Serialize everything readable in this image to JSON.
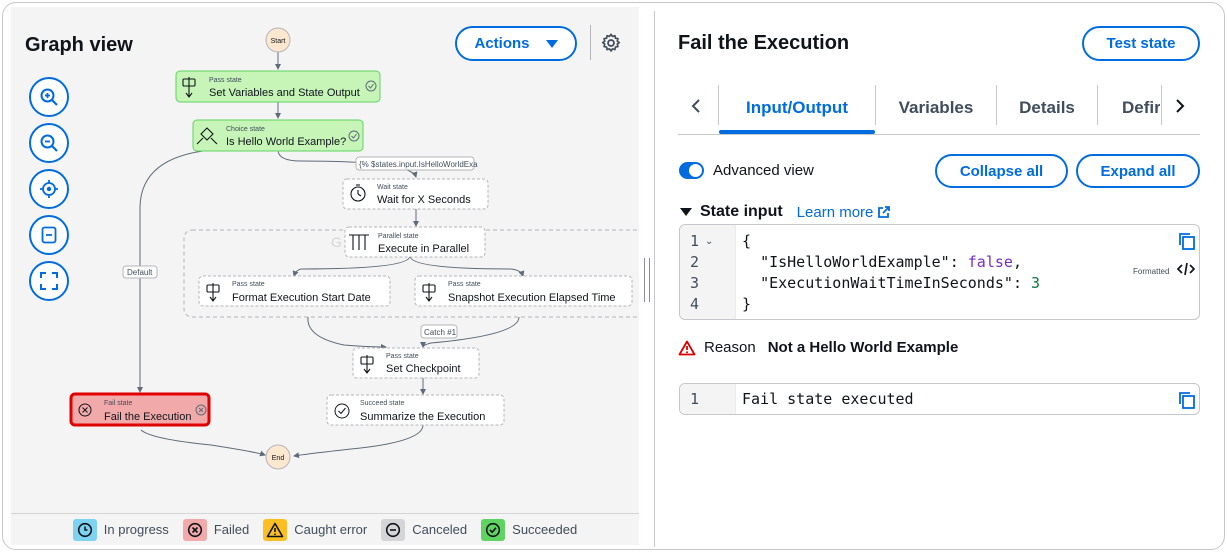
{
  "graph_panel": {
    "title": "Graph view",
    "actions_label": "Actions",
    "zoom_buttons": [
      "zoom-in",
      "zoom-out",
      "center",
      "fit",
      "fullscreen"
    ],
    "nodes": {
      "start": "Start",
      "end": "End",
      "set_vars": {
        "type": "Pass state",
        "name": "Set Variables and State Output"
      },
      "choice": {
        "type": "Choice state",
        "name": "Is Hello World Example?"
      },
      "wait": {
        "type": "Wait state",
        "name": "Wait for X Seconds"
      },
      "parallel": {
        "type": "Parallel state",
        "name": "Execute in Parallel"
      },
      "format_date": {
        "type": "Pass state",
        "name": "Format Execution Start Date"
      },
      "snapshot": {
        "type": "Pass state",
        "name": "Snapshot Execution Elapsed Time"
      },
      "checkpoint": {
        "type": "Pass state",
        "name": "Set Checkpoint"
      },
      "fail": {
        "type": "Fail state",
        "name": "Fail the Execution"
      },
      "succeed": {
        "type": "Succeed state",
        "name": "Summarize the Execution"
      }
    },
    "edge_labels": {
      "condition": "{% $states.input.IsHelloWorldExa",
      "default": "Default",
      "catch": "Catch #1"
    },
    "legend": [
      {
        "label": "In progress",
        "color": "#7dd3f0"
      },
      {
        "label": "Failed",
        "color": "#f2a9a9"
      },
      {
        "label": "Caught error",
        "color": "#fbbf24"
      },
      {
        "label": "Canceled",
        "color": "#d5d5d8"
      },
      {
        "label": "Succeeded",
        "color": "#5fd35f"
      }
    ]
  },
  "detail_panel": {
    "title": "Fail the Execution",
    "test_state_label": "Test state",
    "tabs": [
      {
        "label": "Input/Output",
        "active": true
      },
      {
        "label": "Variables",
        "active": false
      },
      {
        "label": "Details",
        "active": false
      },
      {
        "label": "Defir",
        "active": false
      }
    ],
    "advanced_view_label": "Advanced view",
    "advanced_view_on": true,
    "collapse_all_label": "Collapse all",
    "expand_all_label": "Expand all",
    "state_input_label": "State input",
    "learn_more_label": "Learn more",
    "formatted_label": "Formatted",
    "input_code": {
      "line_numbers": [
        "1",
        "2",
        "3",
        "4"
      ],
      "open_brace": "{",
      "key1": "\"IsHelloWorldExample\"",
      "val1": "false",
      "key2": "\"ExecutionWaitTimeInSeconds\"",
      "val2": "3",
      "close_brace": "}"
    },
    "reason_label": "Reason",
    "reason_value": "Not a Hello World Example",
    "output_code": {
      "line_number": "1",
      "text": "Fail state executed"
    }
  }
}
